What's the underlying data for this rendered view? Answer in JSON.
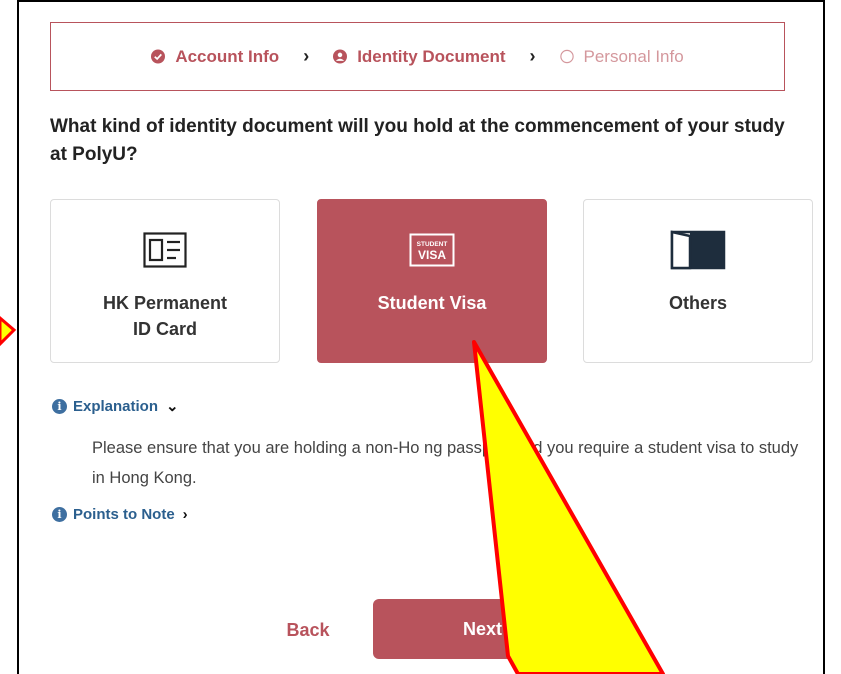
{
  "stepper": {
    "steps": [
      {
        "label": "Account Info",
        "state": "done"
      },
      {
        "label": "Identity Document",
        "state": "active"
      },
      {
        "label": "Personal Info",
        "state": "todo"
      }
    ]
  },
  "question": "What kind of identity document will you hold at the commencement of your study at PolyU?",
  "options": [
    {
      "label_line1": "HK Permanent",
      "label_line2": "ID Card",
      "icon": "id-card-icon",
      "selected": false
    },
    {
      "label": "Student Visa",
      "icon": "student-visa-icon",
      "icon_text_top": "STUDENT",
      "icon_text_bottom": "VISA",
      "selected": true
    },
    {
      "label": "Others",
      "icon": "door-icon",
      "selected": false
    }
  ],
  "explanation": {
    "label": "Explanation",
    "text": "Please ensure that you are holding a non-Ho       ng passport and you require a student visa to study in Hong Kong."
  },
  "points_to_note": {
    "label": "Points to Note"
  },
  "buttons": {
    "back": "Back",
    "next": "Next"
  },
  "colors": {
    "accent": "#b8535c",
    "info": "#3e6fa0",
    "annotation_fill": "#ffff00",
    "annotation_stroke": "#ff0000"
  }
}
